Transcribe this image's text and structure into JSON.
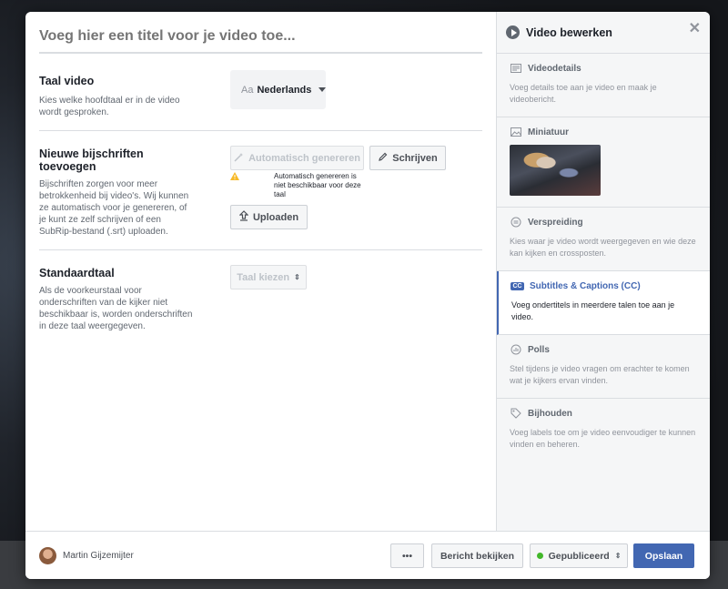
{
  "main": {
    "title_placeholder": "Voeg hier een titel voor je video toe..."
  },
  "language": {
    "title": "Taal video",
    "description": "Kies welke hoofdtaal er in de video wordt gesproken.",
    "prefix": "Aa",
    "value": "Nederlands"
  },
  "captions": {
    "title": "Nieuwe bijschriften toevoegen",
    "description": "Bijschriften zorgen voor meer betrokkenheid bij video's. Wij kunnen ze automatisch voor je genereren, of je kunt ze zelf schrijven of een SubRip-bestand (.srt) uploaden.",
    "auto_label": "Automatisch genereren",
    "write_label": "Schrijven",
    "warning": "Automatisch genereren is niet beschikbaar voor deze taal",
    "upload_label": "Uploaden"
  },
  "default_language": {
    "title": "Standaardtaal",
    "description": "Als de voorkeurstaal voor onderschriften van de kijker niet beschikbaar is, worden onderschriften in deze taal weergegeven.",
    "select_label": "Taal kiezen"
  },
  "sidebar": {
    "title": "Video bewerken",
    "items": [
      {
        "label": "Videodetails",
        "description": "Voeg details toe aan je video en maak je videobericht."
      },
      {
        "label": "Miniatuur",
        "description": ""
      },
      {
        "label": "Verspreiding",
        "description": "Kies waar je video wordt weergegeven en wie deze kan kijken en crossposten."
      },
      {
        "label": "Subtitles & Captions (CC)",
        "badge": "CC",
        "description": "Voeg ondertitels in meerdere talen toe aan je video."
      },
      {
        "label": "Polls",
        "description": "Stel tijdens je video vragen om erachter te komen wat je kijkers ervan vinden."
      },
      {
        "label": "Bijhouden",
        "description": "Voeg labels toe om je video eenvoudiger te kunnen vinden en beheren."
      }
    ]
  },
  "footer": {
    "user_name": "Martin Gijzemijter",
    "more_label": "•••",
    "view_label": "Bericht bekijken",
    "status_label": "Gepubliceerd",
    "save_label": "Opslaan"
  },
  "colors": {
    "accent": "#4267b2",
    "published": "#42b72a",
    "warning": "#f7b928"
  }
}
